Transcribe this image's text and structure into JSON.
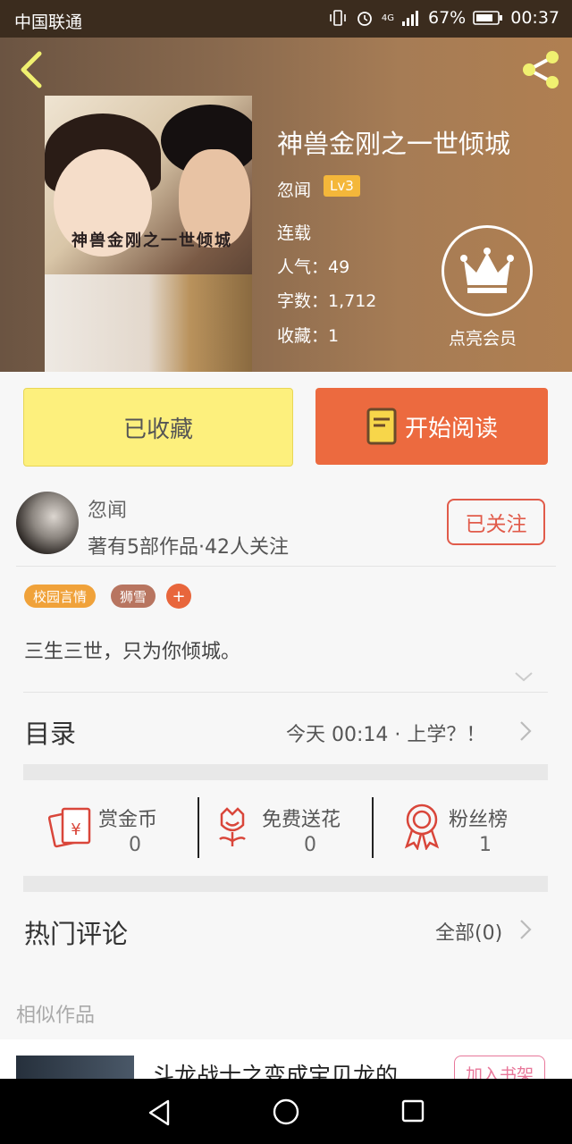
{
  "status_bar": {
    "carrier": "中国联通",
    "network": "4G",
    "battery": "67%",
    "time": "00:37"
  },
  "book": {
    "title": "神兽金刚之一世倾城",
    "cover_title": "神兽金刚之一世倾城",
    "author": "忽闻",
    "level": "Lv3",
    "status": "连载",
    "popularity": "人气：49",
    "word_count": "字数：1,712",
    "favorites": "收藏：1",
    "member_label": "点亮会员"
  },
  "actions": {
    "collected_label": "已收藏",
    "read_label": "开始阅读"
  },
  "author_info": {
    "name": "忽闻",
    "stats": "著有5部作品·42人关注",
    "follow_label": "已关注"
  },
  "tags": [
    {
      "label": "校园言情",
      "color": "#f0a23a"
    },
    {
      "label": "狮雪",
      "color": "#b87560"
    },
    {
      "label": "+",
      "color": "#e8663c"
    }
  ],
  "description": "三生三世，只为你倾城。",
  "catalog": {
    "title": "目录",
    "latest": "今天 00:14 · 上学？！"
  },
  "stats": [
    {
      "label": "赏金币",
      "value": "0",
      "icon": "red-envelope-icon"
    },
    {
      "label": "免费送花",
      "value": "0",
      "icon": "flower-icon"
    },
    {
      "label": "粉丝榜",
      "value": "1",
      "icon": "medal-icon"
    }
  ],
  "comments": {
    "title": "热门评论",
    "all_label": "全部(0)"
  },
  "similar": {
    "label": "相似作品",
    "item_title": "斗龙战士之变成宝贝龙的",
    "shelf_label": "加入书架"
  }
}
